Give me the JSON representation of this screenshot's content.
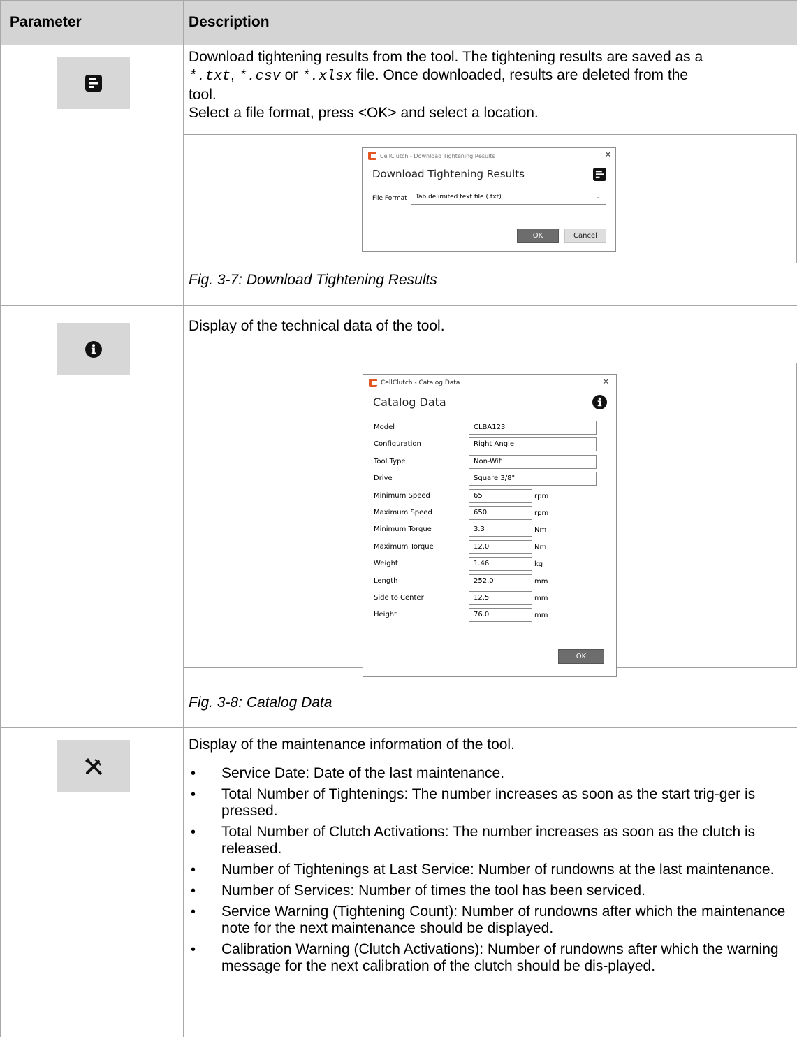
{
  "table": {
    "headers": {
      "parameter": "Parameter",
      "description": "Description"
    }
  },
  "row1": {
    "icon": "download-results-icon",
    "text_p1_a": "Download tightening results from the tool. The tightening results are saved as a",
    "ext_txt": "*.txt",
    "sep1": ",",
    "ext_csv": "*.csv",
    "or": "or",
    "ext_xlsx": "*.xlsx",
    "text_p1_b": "file.  Once downloaded, results are deleted from the",
    "text_p1_c": "tool.",
    "text_p2": "Select a file format, press <OK> and select a location.",
    "dialog": {
      "window_title": "CellClutch - Download Tightening Results",
      "heading": "Download Tightening Results",
      "file_format_label": "File Format",
      "file_format_value": "Tab delimited text file (.txt)",
      "ok": "OK",
      "cancel": "Cancel",
      "close": "×"
    },
    "caption": "Fig. 3-7: Download Tightening Results"
  },
  "row2": {
    "icon": "info-icon",
    "text": "Display of the technical data of the tool.",
    "dialog": {
      "window_title": "CellClutch - Catalog Data",
      "heading": "Catalog Data",
      "close": "×",
      "ok": "OK",
      "fields": [
        {
          "label": "Model",
          "value": "CLBA123",
          "unit": ""
        },
        {
          "label": "Configuration",
          "value": "Right Angle",
          "unit": ""
        },
        {
          "label": "Tool Type",
          "value": "Non-Wifi",
          "unit": ""
        },
        {
          "label": "Drive",
          "value": "Square 3/8\"",
          "unit": ""
        },
        {
          "label": "Minimum Speed",
          "value": "65",
          "unit": "rpm"
        },
        {
          "label": "Maximum Speed",
          "value": "650",
          "unit": "rpm"
        },
        {
          "label": "Minimum Torque",
          "value": "3.3",
          "unit": "Nm"
        },
        {
          "label": "Maximum Torque",
          "value": "12.0",
          "unit": "Nm"
        },
        {
          "label": "Weight",
          "value": "1.46",
          "unit": "kg"
        },
        {
          "label": "Length",
          "value": "252.0",
          "unit": "mm"
        },
        {
          "label": "Side to Center",
          "value": "12.5",
          "unit": "mm"
        },
        {
          "label": "Height",
          "value": "76.0",
          "unit": "mm"
        }
      ]
    },
    "caption": "Fig. 3-8: Catalog Data"
  },
  "row3": {
    "icon": "tools-icon",
    "text": "Display of the maintenance information of the tool.",
    "bullets": [
      "Service Date: Date of the last maintenance.",
      "Total Number of Tightenings: The number increases as soon as the start trig-ger is pressed.",
      "Total Number of Clutch Activations: The number increases as soon as the clutch is released.",
      "Number of Tightenings at Last Service: Number of rundowns at the last maintenance.",
      "Number of Services: Number of times the tool has been serviced.",
      "Service Warning (Tightening Count): Number of rundowns after which the maintenance note for the next maintenance should be displayed.",
      "Calibration Warning (Clutch Activations): Number of rundowns after which the warning message for the next calibration of the clutch should be dis-played."
    ]
  }
}
